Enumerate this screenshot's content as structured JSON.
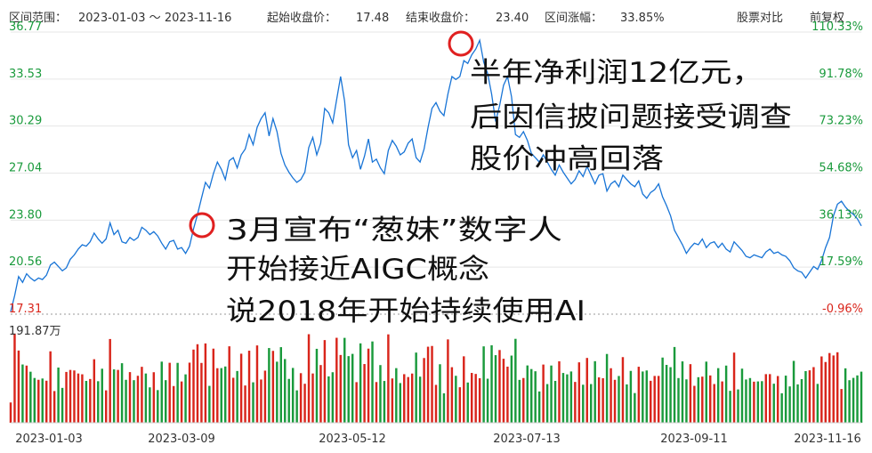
{
  "header": {
    "range_label": "区间范围：",
    "range_value": "2023-01-03 ～ 2023-11-16",
    "start_label": "起始收盘价：",
    "start_value": "17.48",
    "end_label": "结束收盘价：",
    "end_value": "23.40",
    "change_label": "区间涨幅：",
    "change_value": "33.85%",
    "compare_button": "股票对比",
    "adjust_button": "前复权"
  },
  "volume_label": "191.87万",
  "annotations": {
    "march": [
      "3月宣布“葱妹”数字人",
      "开始接近AIGC概念",
      "说2018年开始持续使用AI"
    ],
    "peak": [
      "半年净利润12亿元，",
      "后因信披问题接受调查",
      "股价冲高回落"
    ]
  },
  "colors": {
    "line": "#1874d6",
    "up": "#d9251b",
    "down": "#1a9a3c",
    "grid": "#e6e6e6",
    "marker": "#e02020"
  },
  "chart_data": {
    "type": "line",
    "y_ticks_left": [
      "36.77",
      "33.53",
      "30.29",
      "27.04",
      "23.80",
      "20.56",
      "17.31"
    ],
    "y_ticks_right": [
      "110.33%",
      "91.78%",
      "73.23%",
      "54.68%",
      "36.13%",
      "17.59%",
      "-0.96%"
    ],
    "x_ticks": [
      "2023-01-03",
      "2023-03-09",
      "2023-05-12",
      "2023-07-13",
      "2023-09-11",
      "2023-11-16"
    ],
    "ylim": [
      17.31,
      36.77
    ],
    "close": [
      17.48,
      18.6,
      19.9,
      19.5,
      20.1,
      19.8,
      19.6,
      19.8,
      19.7,
      20.0,
      20.7,
      20.9,
      20.6,
      20.3,
      20.5,
      21.1,
      21.4,
      21.8,
      22.1,
      22.0,
      22.3,
      22.9,
      22.5,
      22.2,
      22.5,
      23.6,
      22.8,
      23.1,
      22.3,
      22.2,
      22.6,
      22.4,
      22.6,
      23.3,
      23.1,
      22.8,
      23.0,
      22.7,
      22.2,
      21.8,
      22.3,
      22.4,
      21.8,
      21.9,
      21.5,
      22.0,
      23.2,
      24.2,
      25.3,
      26.4,
      26.0,
      27.0,
      27.8,
      27.3,
      26.6,
      27.9,
      28.1,
      27.4,
      28.3,
      28.7,
      29.7,
      29.0,
      30.2,
      30.8,
      31.2,
      29.6,
      30.8,
      29.9,
      28.4,
      27.6,
      27.1,
      26.7,
      26.4,
      26.6,
      27.1,
      28.8,
      29.5,
      28.3,
      29.1,
      31.5,
      31.2,
      30.5,
      32.1,
      33.7,
      32.0,
      29.0,
      28.1,
      28.6,
      27.3,
      28.2,
      29.4,
      27.8,
      28.0,
      27.4,
      27.0,
      28.6,
      29.3,
      28.9,
      28.3,
      28.5,
      29.1,
      29.4,
      28.1,
      27.8,
      28.7,
      30.2,
      31.5,
      31.9,
      31.3,
      31.0,
      32.5,
      33.7,
      33.5,
      33.7,
      34.8,
      34.6,
      35.2,
      35.6,
      36.2,
      34.7,
      33.9,
      32.5,
      30.6,
      31.7,
      33.1,
      33.7,
      32.3,
      29.7,
      29.5,
      29.9,
      29.3,
      28.4,
      28.1,
      27.8,
      28.3,
      27.8,
      27.3,
      26.9,
      27.6,
      27.1,
      26.7,
      26.3,
      26.6,
      27.2,
      26.8,
      27.5,
      26.9,
      26.3,
      26.9,
      27.0,
      25.8,
      26.3,
      26.5,
      26.1,
      26.9,
      26.6,
      26.3,
      26.1,
      26.5,
      25.6,
      25.3,
      25.7,
      25.9,
      26.3,
      25.4,
      24.8,
      24.1,
      23.1,
      22.6,
      22.1,
      21.5,
      21.9,
      22.2,
      22.1,
      22.5,
      21.9,
      22.2,
      22.3,
      21.9,
      22.2,
      21.8,
      21.6,
      22.3,
      22.0,
      21.7,
      21.3,
      21.2,
      21.4,
      21.3,
      21.2,
      21.6,
      21.8,
      21.5,
      21.6,
      21.4,
      21.3,
      21.0,
      20.5,
      20.3,
      20.2,
      19.8,
      20.2,
      20.6,
      20.4,
      21.0,
      21.9,
      22.6,
      24.1,
      24.9,
      25.1,
      24.7,
      24.4,
      24.2,
      23.9,
      23.4
    ]
  }
}
